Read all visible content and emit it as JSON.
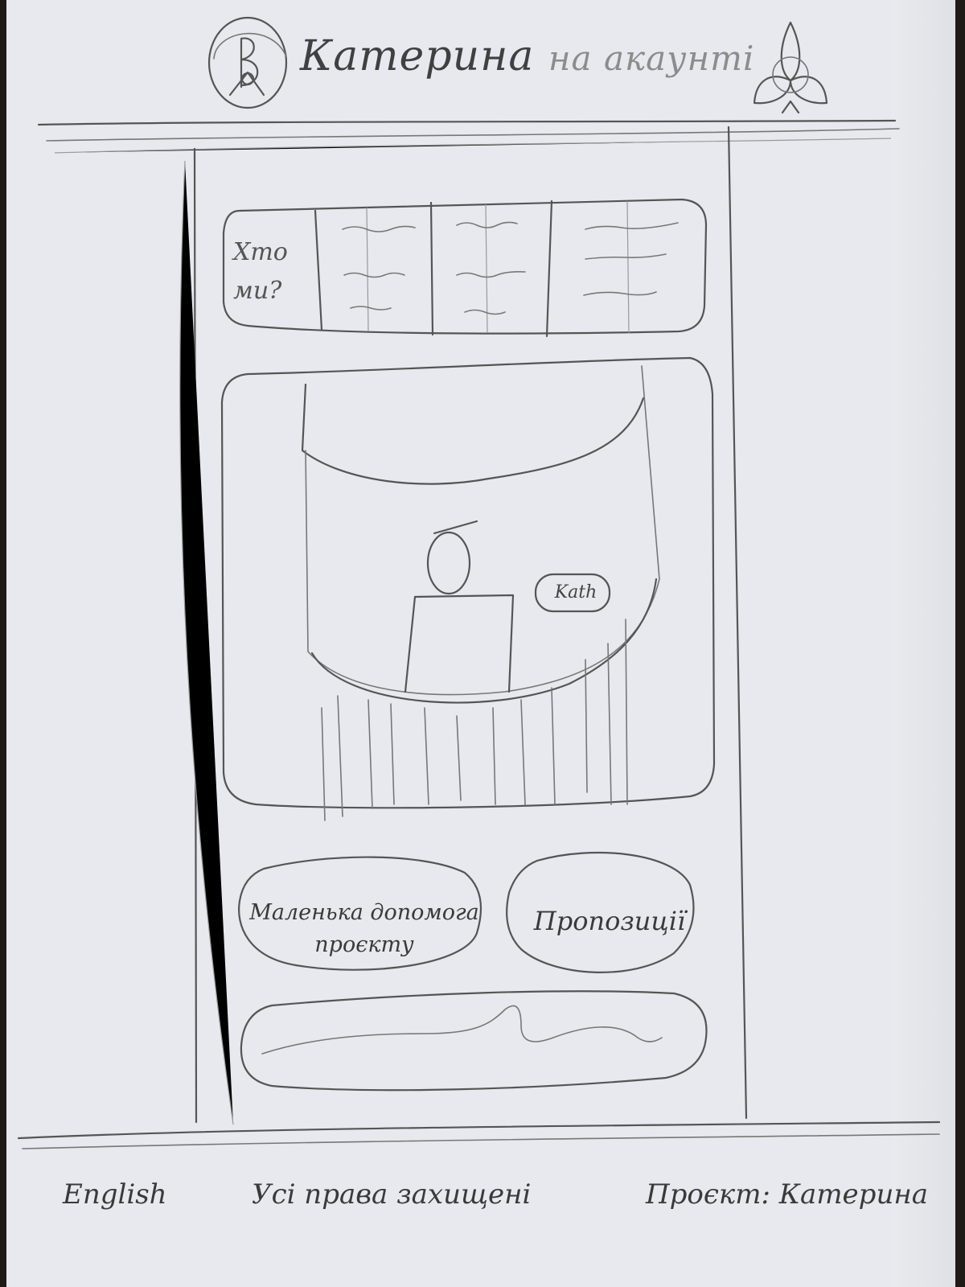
{
  "header": {
    "logo_icon": "monogram-emblem-icon",
    "title_main": "Катерина",
    "title_sub": "на акаунті",
    "menu_icon": "triquetra-menu-icon"
  },
  "about_strip": {
    "label": "Хто\nми?"
  },
  "hero": {
    "tag": "Kath",
    "image_icon": "person-portrait-icon"
  },
  "actions": {
    "help_label": "Маленька допомога\nпроєкту",
    "offers_label": "Пропозиції"
  },
  "footer": {
    "language": "English",
    "rights": "Усі права захищені",
    "project": "Проєкт: Катерина"
  }
}
